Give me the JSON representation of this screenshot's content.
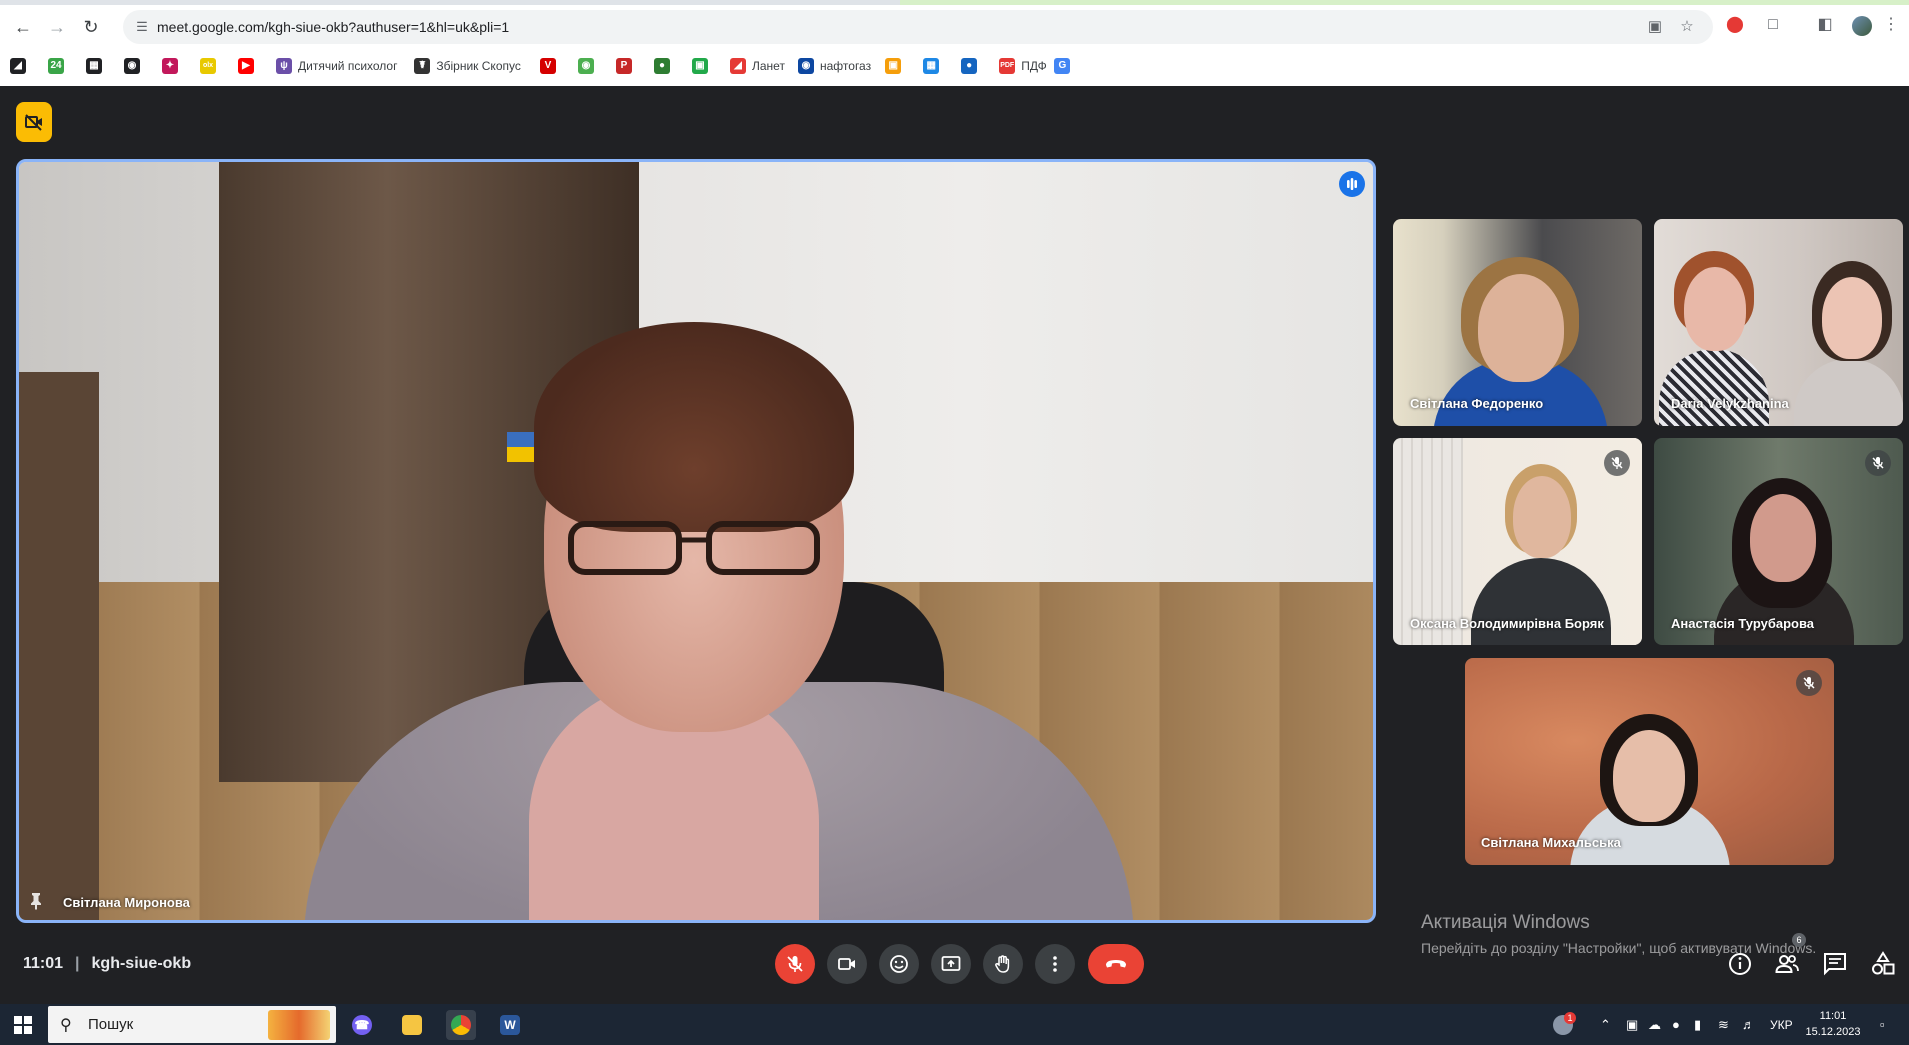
{
  "browser": {
    "url": "meet.google.com/kgh-siue-okb?authuser=1&hl=uk&pli=1",
    "bookmarks": [
      {
        "label": "",
        "icon": "bookmark-icon-1",
        "color": "#202124"
      },
      {
        "label": "",
        "icon": "bookmark-24-icon",
        "color": "#3aa548"
      },
      {
        "label": "",
        "icon": "bookmark-film-icon",
        "color": "#202124"
      },
      {
        "label": "",
        "icon": "bookmark-globe-icon",
        "color": "#202124"
      },
      {
        "label": "",
        "icon": "bookmark-star-icon",
        "color": "#c2185b"
      },
      {
        "label": "",
        "icon": "bookmark-olx-icon",
        "color": "#e8c900"
      },
      {
        "label": "",
        "icon": "youtube-icon",
        "color": "#ff0000"
      },
      {
        "label": "Дитячий психолог",
        "icon": "bookmark-psychologist-icon",
        "color": "#6b4fa8"
      },
      {
        "label": "Збірник Скопус",
        "icon": "bookmark-scopus-icon",
        "color": "#333333"
      },
      {
        "label": "",
        "icon": "bookmark-v-icon",
        "color": "#d50000"
      },
      {
        "label": "",
        "icon": "bookmark-frog-icon",
        "color": "#4caf50"
      },
      {
        "label": "",
        "icon": "bookmark-p-icon",
        "color": "#c62828"
      },
      {
        "label": "",
        "icon": "bookmark-green-circle-icon",
        "color": "#2e7d32"
      },
      {
        "label": "",
        "icon": "bookmark-chat-icon",
        "color": "#22a94a"
      },
      {
        "label": "Ланет",
        "icon": "bookmark-lanet-icon",
        "color": "#e53935"
      },
      {
        "label": "нафтогаз",
        "icon": "bookmark-naftogaz-icon",
        "color": "#0d47a1"
      },
      {
        "label": "",
        "icon": "bookmark-orange-icon",
        "color": "#f59e0b"
      },
      {
        "label": "",
        "icon": "bookmark-grid-icon",
        "color": "#1e88e5"
      },
      {
        "label": "",
        "icon": "bookmark-drop-icon",
        "color": "#1565c0"
      },
      {
        "label": "ПДФ",
        "icon": "bookmark-pdf24-icon",
        "color": "#e53935"
      },
      {
        "label": "",
        "icon": "google-translate-icon",
        "color": "#4285f4"
      }
    ]
  },
  "meet": {
    "main_tile": {
      "name": "Світлана Миронова"
    },
    "participants": [
      {
        "name": "Світлана Федоренко",
        "muted": false
      },
      {
        "name": "Daria Velykzhanina",
        "muted": false
      },
      {
        "name": "Оксана Володимирівна Боряк",
        "muted": true
      },
      {
        "name": "Анастасія Турубарова",
        "muted": true
      },
      {
        "name": "Світлана Михальська",
        "muted": true
      }
    ],
    "bottom": {
      "time": "11:01",
      "separator": "|",
      "meeting_code": "kgh-siue-okb"
    },
    "people_badge": "6"
  },
  "windows_activation": {
    "title": "Активація Windows",
    "subtitle": "Перейдіть до розділу \"Настройки\", щоб активувати Windows."
  },
  "taskbar": {
    "search_placeholder": "Пошук",
    "language": "УКР",
    "time": "11:01",
    "date": "15.12.2023",
    "notification_count": "1"
  },
  "colors": {
    "meet_bg": "#202124",
    "active_speaker_border": "#8ab4f8",
    "end_call": "#ea4335",
    "mic_off": "#ea4335",
    "no_camera_badge": "#fbbc04",
    "taskbar_bg": "#1c2634"
  }
}
